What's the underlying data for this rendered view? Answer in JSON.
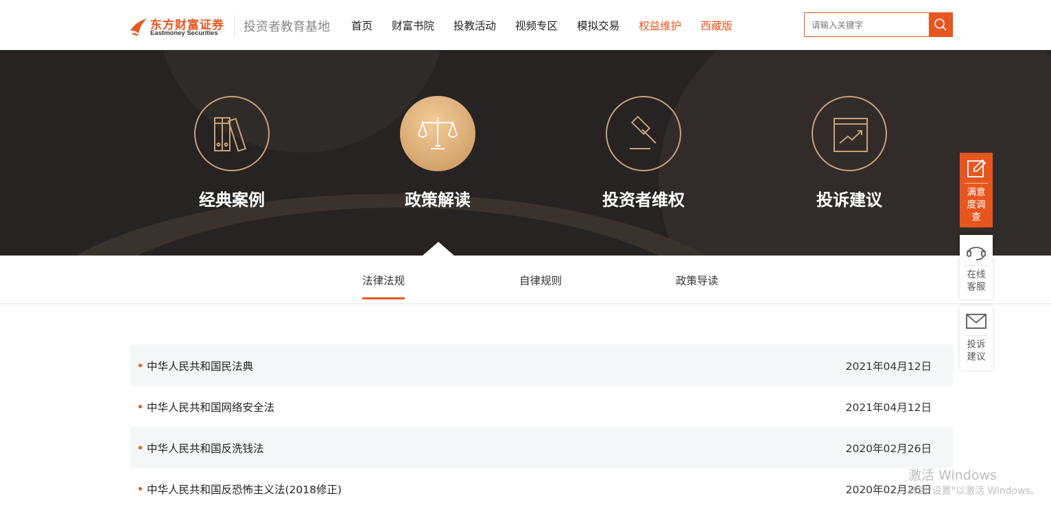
{
  "brand": {
    "name_cn": "东方财富证券",
    "name_en": "Eastmoney Securities",
    "subtitle": "投资者教育基地",
    "color": "#e8561f"
  },
  "nav": [
    {
      "label": "首页",
      "highlight": false
    },
    {
      "label": "财富书院",
      "highlight": false
    },
    {
      "label": "投教活动",
      "highlight": false
    },
    {
      "label": "视频专区",
      "highlight": false
    },
    {
      "label": "模拟交易",
      "highlight": false
    },
    {
      "label": "权益维护",
      "highlight": true
    },
    {
      "label": "西藏版",
      "highlight": true
    }
  ],
  "search": {
    "placeholder": "请输入关键字",
    "icon": "search-icon"
  },
  "categories": [
    {
      "label": "经典案例",
      "icon": "books-icon",
      "active": false
    },
    {
      "label": "政策解读",
      "icon": "scales-icon",
      "active": true
    },
    {
      "label": "投资者维权",
      "icon": "gavel-icon",
      "active": false
    },
    {
      "label": "投诉建议",
      "icon": "chart-book-icon",
      "active": false
    }
  ],
  "tabs": [
    {
      "label": "法律法规",
      "active": true
    },
    {
      "label": "自律规则",
      "active": false
    },
    {
      "label": "政策导读",
      "active": false
    }
  ],
  "articles": [
    {
      "title": "中华人民共和国民法典",
      "date": "2021年04月12日"
    },
    {
      "title": "中华人民共和国网络安全法",
      "date": "2021年04月12日"
    },
    {
      "title": "中华人民共和国反洗钱法",
      "date": "2020年02月26日"
    },
    {
      "title": "中华人民共和国反恐怖主义法(2018修正)",
      "date": "2020年02月26日"
    }
  ],
  "side_widgets": [
    {
      "label": "满意度调查",
      "icon": "survey-edit-icon"
    },
    {
      "label": "在线客服",
      "icon": "headset-icon"
    },
    {
      "label": "投诉建议",
      "icon": "mail-icon"
    }
  ],
  "watermark": {
    "line1": "激活 Windows",
    "line2": "转到\"设置\"以激活 Windows。"
  }
}
